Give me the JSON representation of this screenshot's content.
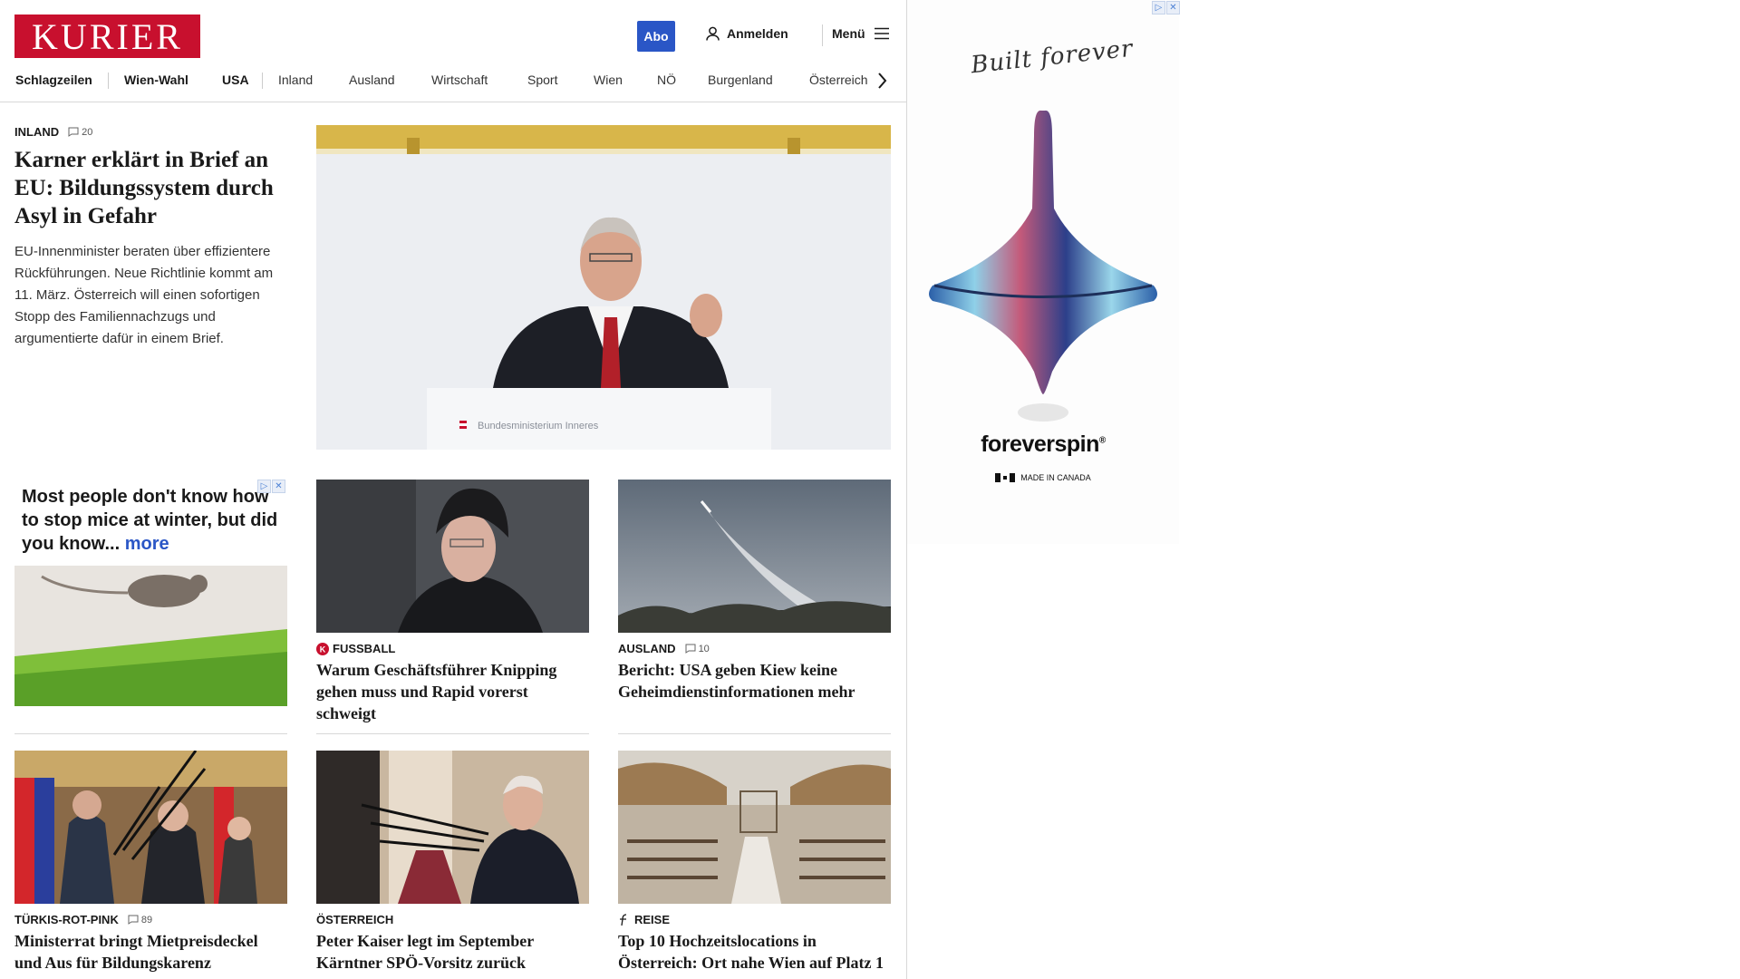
{
  "header": {
    "logo": "KURIER",
    "abo_label": "Abo",
    "login_label": "Anmelden",
    "menu_label": "Menü"
  },
  "nav": [
    "Schlagzeilen",
    "Wien-Wahl",
    "USA",
    "Inland",
    "Ausland",
    "Wirtschaft",
    "Sport",
    "Wien",
    "NÖ",
    "Burgenland",
    "Österreich"
  ],
  "lead": {
    "kicker": "INLAND",
    "comments": "20",
    "title": "Karner erklärt in Brief an EU: Bildungssystem durch Asyl in Gefahr",
    "teaser": "EU-Innenminister beraten über effizientere Rückführungen. Neue Richtlinie kommt am 11. März. Österreich will einen sofortigen Stopp des Familiennachzugs und argumentierte dafür in einem Brief.",
    "image_caption": "Bundesministerium Inneres"
  },
  "ad_small": {
    "text": "Most people don't know how to stop mice at winter, but did you know...",
    "more": "more"
  },
  "cards": [
    {
      "kicker": "FUSSBALL",
      "comments": "",
      "title": "Warum Geschäftsführer Knipping gehen muss und Rapid vorerst schweigt"
    },
    {
      "kicker": "AUSLAND",
      "comments": "10",
      "title": "Bericht: USA geben Kiew keine Geheimdienstinformationen mehr"
    },
    {
      "kicker": "TÜRKIS-ROT-PINK",
      "comments": "89",
      "title": "Ministerrat bringt Mietpreisdeckel und Aus für Bildungskarenz"
    },
    {
      "kicker": "ÖSTERREICH",
      "comments": "",
      "title": "Peter Kaiser legt im September Kärntner SPÖ-Vorsitz zurück"
    },
    {
      "kicker": "REISE",
      "comments": "",
      "title": "Top 10 Hochzeitslocations in Österreich: Ort nahe Wien auf Platz 1"
    }
  ],
  "ad_right": {
    "signature": "Built forever",
    "brand": "foreverspin",
    "sub": "MADE IN CANADA"
  },
  "colors": {
    "brand_red": "#c8102e",
    "abo_blue": "#2a56c6"
  }
}
